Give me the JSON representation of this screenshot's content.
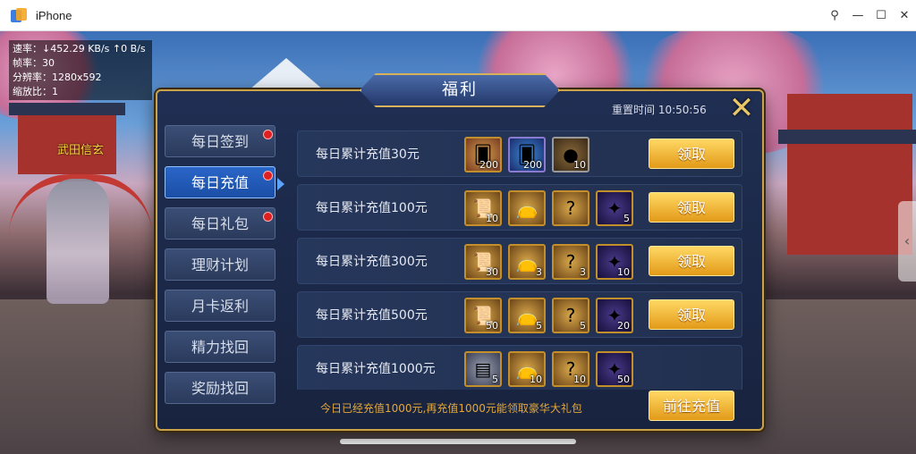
{
  "window": {
    "title": "iPhone",
    "controls": [
      "pin-icon",
      "minimize-icon",
      "maximize-icon",
      "close-icon"
    ]
  },
  "stats": {
    "speed": "速率：↓452.29 KB/s  ↑0 B/s",
    "fps": "帧率：30",
    "resolution": "分辨率：1280x592",
    "scale": "缩放比：1"
  },
  "scene": {
    "npc_name": "武田信玄"
  },
  "panel": {
    "title": "福利",
    "reset_time": "重置时间 10:50:56",
    "close_symbol": "✕"
  },
  "sidebar": {
    "items": [
      {
        "label": "每日签到",
        "badge": true,
        "active": false
      },
      {
        "label": "每日充值",
        "badge": true,
        "active": true
      },
      {
        "label": "每日礼包",
        "badge": true,
        "active": false
      },
      {
        "label": "理财计划",
        "badge": false,
        "active": false
      },
      {
        "label": "月卡返利",
        "badge": false,
        "active": false
      },
      {
        "label": "精力找回",
        "badge": false,
        "active": false
      },
      {
        "label": "奖励找回",
        "badge": false,
        "active": false
      }
    ]
  },
  "rows": [
    {
      "label": "每日累计充值30元",
      "button": "领取",
      "items": [
        {
          "icon": "red-hero-card-icon",
          "count": "200"
        },
        {
          "icon": "blue-hero-card-icon",
          "count": "200"
        },
        {
          "icon": "coin-icon",
          "count": "10"
        }
      ]
    },
    {
      "label": "每日累计充值100元",
      "button": "领取",
      "items": [
        {
          "icon": "scroll-icon",
          "count": "10"
        },
        {
          "icon": "red-bag-icon",
          "count": ""
        },
        {
          "icon": "mystery-box-icon",
          "count": ""
        },
        {
          "icon": "purple-flame-icon",
          "count": "5"
        }
      ]
    },
    {
      "label": "每日累计充值300元",
      "button": "领取",
      "items": [
        {
          "icon": "scroll-icon",
          "count": "30"
        },
        {
          "icon": "red-bag-icon",
          "count": "3"
        },
        {
          "icon": "mystery-box-icon",
          "count": "3"
        },
        {
          "icon": "purple-flame-icon",
          "count": "10"
        }
      ]
    },
    {
      "label": "每日累计充值500元",
      "button": "领取",
      "items": [
        {
          "icon": "scroll-icon",
          "count": "50"
        },
        {
          "icon": "red-bag-icon",
          "count": "5"
        },
        {
          "icon": "mystery-box-icon",
          "count": "5"
        },
        {
          "icon": "purple-flame-icon",
          "count": "20"
        }
      ]
    },
    {
      "label": "每日累计充值1000元",
      "button": "",
      "items": [
        {
          "icon": "silver-chest-icon",
          "count": "5"
        },
        {
          "icon": "red-bag-icon",
          "count": "10"
        },
        {
          "icon": "mystery-box-icon",
          "count": "10"
        },
        {
          "icon": "purple-flame-icon",
          "count": "50"
        }
      ]
    }
  ],
  "footer": {
    "note": "今日已经充值1000元,再充值1000元能领取豪华大礼包",
    "recharge_button": "前往充值"
  },
  "colors": {
    "accent_gold": "#e29a18",
    "panel_bg": "#1f2e52",
    "active_tab": "#2a66c8",
    "badge_red": "#e02020"
  }
}
